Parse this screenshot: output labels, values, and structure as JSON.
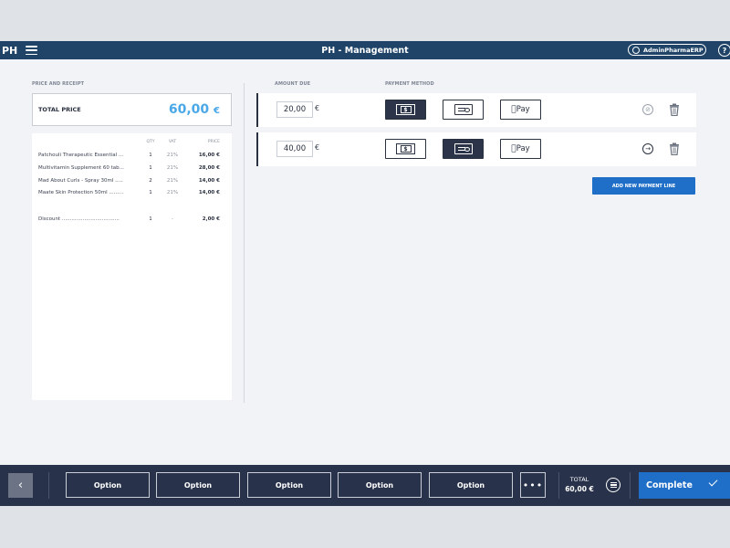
{
  "header": {
    "brand": "PH",
    "title": "PH - Management",
    "user": "AdminPharmaERP",
    "help": "?"
  },
  "left": {
    "section_label": "PRICE AND RECEIPT",
    "total_label": "TOTAL PRICE",
    "total_amount": "60,00",
    "total_currency": "€",
    "columns": {
      "qty": "QTY",
      "vat": "VAT",
      "price": "PRICE"
    },
    "items": [
      {
        "name": "Patchouli Therapeutic Essential ...",
        "qty": "1",
        "vat": "21%",
        "price": "16,00 €"
      },
      {
        "name": "Multivitamin Supplement 60 tab...",
        "qty": "1",
        "vat": "21%",
        "price": "28,00 €"
      },
      {
        "name": "Mad About Curls - Spray 30ml .....",
        "qty": "2",
        "vat": "21%",
        "price": "14,00 €"
      },
      {
        "name": "Maate Skin Protection 50ml .........",
        "qty": "1",
        "vat": "21%",
        "price": "14,00 €"
      }
    ],
    "discount": {
      "name": "Discount ....................................",
      "qty": "1",
      "vat": "-",
      "price": "2,00 €"
    }
  },
  "right": {
    "amount_due_label": "AMOUNT DUE",
    "payment_method_label": "PAYMENT METHOD",
    "lines": [
      {
        "amount": "20,00",
        "currency": "€",
        "selected_method": "cash",
        "action_icon": "disabled-circle-icon"
      },
      {
        "amount": "40,00",
        "currency": "€",
        "selected_method": "card",
        "action_icon": "arrow-right-circle-icon"
      }
    ],
    "methods": {
      "cash_symbol": "$",
      "applepay_label": "Pay"
    },
    "add_line_label": "ADD NEW PAYMENT LINE"
  },
  "footer": {
    "options": [
      "Option",
      "Option",
      "Option",
      "Option",
      "Option"
    ],
    "more_label": "•••",
    "total_label": "TOTAL",
    "total_value": "60,00 €",
    "complete_label": "Complete"
  },
  "colors": {
    "header_bg": "#1f4468",
    "footer_bg": "#28324a",
    "accent": "#1f6ec8",
    "total_amount": "#4aa8e8"
  }
}
